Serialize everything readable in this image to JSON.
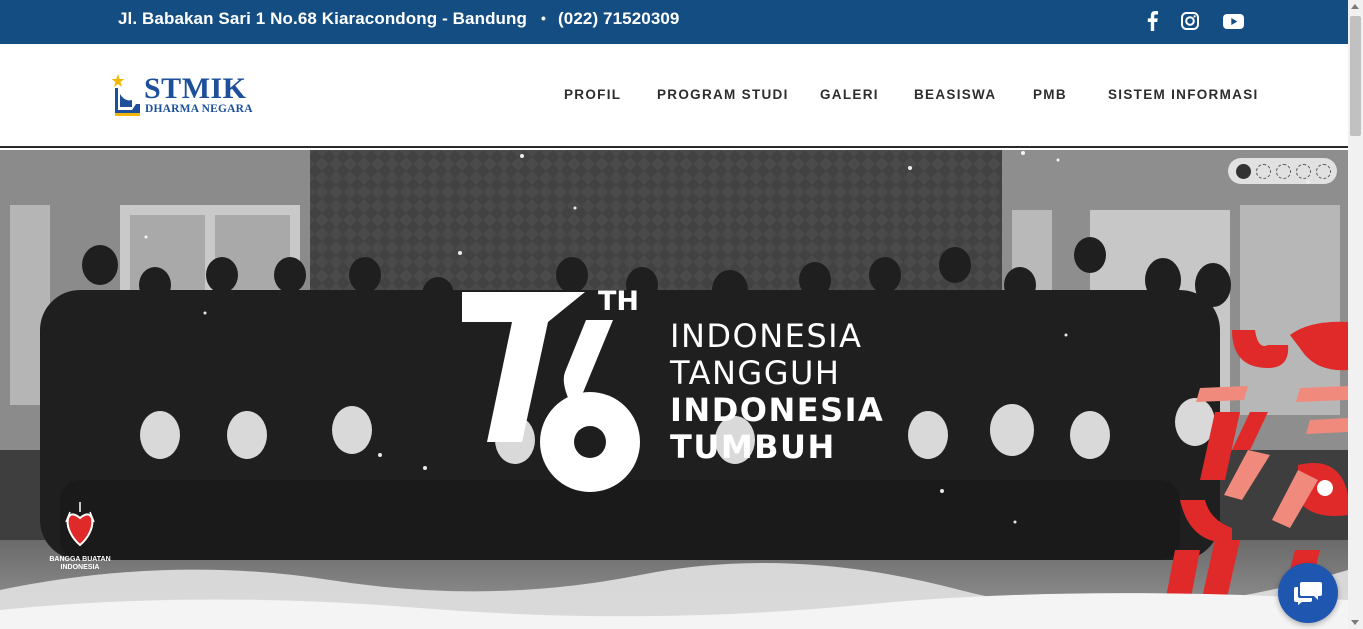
{
  "topbar": {
    "address": "Jl. Babakan Sari 1 No.68 Kiaracondong - Bandung",
    "separator": "•",
    "phone": "(022) 71520309",
    "social_icons": [
      "facebook-icon",
      "instagram-icon",
      "youtube-icon"
    ],
    "background_color": "#134d82"
  },
  "logo": {
    "title": "STMIK",
    "subtitle": "DHARMA NEGARA",
    "color": "#1d4f9a"
  },
  "nav": {
    "items": [
      {
        "label": "PROFIL"
      },
      {
        "label": "PROGRAM STUDI"
      },
      {
        "label": "GALERI"
      },
      {
        "label": "BEASISWA"
      },
      {
        "label": "PMB"
      },
      {
        "label": "SISTEM INFORMASI"
      }
    ]
  },
  "hero": {
    "ordinal_suffix": "TH",
    "line1": "INDONESIA",
    "line2": "TANGGUH",
    "line3": "INDONESIA",
    "line4": "TUMBUH",
    "badge_line1": "BANGGA BUATAN",
    "badge_line2": "INDONESIA",
    "slider": {
      "count": 5,
      "active_index": 0
    },
    "accent_color": "#e02a2a"
  },
  "chat": {
    "icon": "chat-bubbles-icon",
    "color": "#1f56b0"
  }
}
